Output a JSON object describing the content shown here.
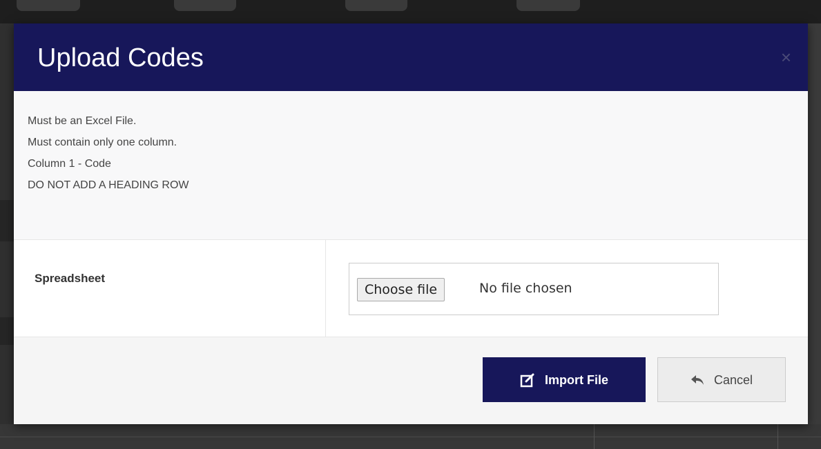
{
  "modal": {
    "title": "Upload Codes",
    "close_label": "×",
    "instructions": [
      "Must be an Excel File.",
      "Must contain only one column.",
      "Column 1 - Code",
      "DO NOT ADD A HEADING ROW"
    ],
    "field_label": "Spreadsheet",
    "file_input": {
      "button_label": "Choose file",
      "status": "No file chosen"
    },
    "buttons": {
      "import_label": "Import File",
      "import_icon": "edit-square-icon",
      "cancel_label": "Cancel",
      "cancel_icon": "reply-arrow-icon"
    }
  },
  "colors": {
    "header_bg": "#17175a",
    "primary_button": "#17175a",
    "backdrop": "#2d2d2d"
  }
}
